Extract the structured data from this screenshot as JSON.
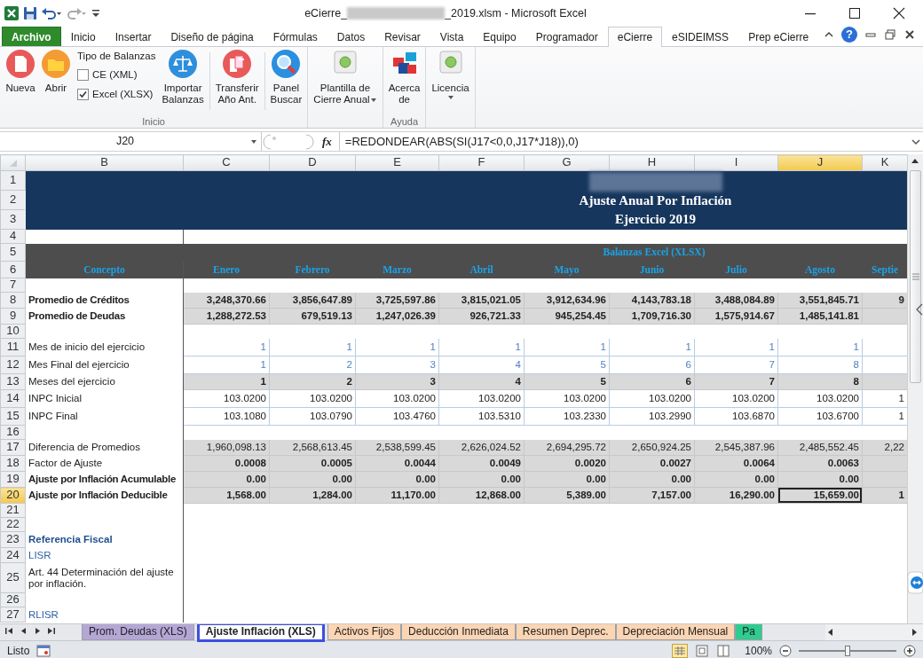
{
  "window": {
    "title_start": "eCierre_",
    "title_end": "_2019.xlsm  -  Microsoft Excel"
  },
  "ribbon": {
    "tabs": [
      {
        "label": "Archivo",
        "kind": "file",
        "selected": false
      },
      {
        "label": "Inicio",
        "kind": "tab",
        "selected": false
      },
      {
        "label": "Insertar",
        "kind": "tab",
        "selected": false
      },
      {
        "label": "Diseño de página",
        "kind": "tab",
        "selected": false
      },
      {
        "label": "Fórmulas",
        "kind": "tab",
        "selected": false
      },
      {
        "label": "Datos",
        "kind": "tab",
        "selected": false
      },
      {
        "label": "Revisar",
        "kind": "tab",
        "selected": false
      },
      {
        "label": "Vista",
        "kind": "tab",
        "selected": false
      },
      {
        "label": "Equipo",
        "kind": "tab",
        "selected": false
      },
      {
        "label": "Programador",
        "kind": "tab",
        "selected": false
      },
      {
        "label": "eCierre",
        "kind": "tab",
        "selected": true
      },
      {
        "label": "eSIDEIMSS",
        "kind": "tab",
        "selected": false
      },
      {
        "label": "Prep eCierre",
        "kind": "tab",
        "selected": false
      }
    ],
    "help": "?",
    "groups": [
      {
        "label": "Inicio",
        "items": [
          {
            "kind": "button",
            "lines": [
              "Nueva"
            ]
          },
          {
            "kind": "button",
            "lines": [
              "Abrir"
            ]
          },
          {
            "kind": "options",
            "title": "Tipo de Balanzas",
            "options": [
              {
                "label": "CE (XML)",
                "checked": false
              },
              {
                "label": "Excel (XLSX)",
                "checked": true
              }
            ]
          },
          {
            "kind": "button",
            "lines": [
              "Importar",
              "Balanzas"
            ]
          },
          {
            "kind": "separator"
          },
          {
            "kind": "button",
            "lines": [
              "Transferir",
              "Año Ant."
            ]
          },
          {
            "kind": "separator"
          },
          {
            "kind": "button",
            "lines": [
              "Panel",
              "Buscar"
            ]
          }
        ]
      },
      {
        "items": [
          {
            "kind": "button",
            "lines": [
              "Plantilla de",
              "Cierre Anual"
            ],
            "dropdown": true
          }
        ]
      },
      {
        "label": "Ayuda",
        "items": [
          {
            "kind": "button",
            "lines": [
              "Acerca",
              "de"
            ]
          }
        ]
      },
      {
        "items": [
          {
            "kind": "button",
            "lines": [
              "Licencia"
            ],
            "dropdown": true
          }
        ]
      }
    ]
  },
  "formula_bar": {
    "name_box": "J20",
    "function_label": "fx",
    "formula": "=REDONDEAR(ABS(SI(J17<0,0,J17*J18)),0)"
  },
  "sheet": {
    "columns": [
      {
        "letter": "B",
        "selected": false
      },
      {
        "letter": "C",
        "selected": false
      },
      {
        "letter": "D",
        "selected": false
      },
      {
        "letter": "E",
        "selected": false
      },
      {
        "letter": "F",
        "selected": false
      },
      {
        "letter": "G",
        "selected": false
      },
      {
        "letter": "H",
        "selected": false
      },
      {
        "letter": "I",
        "selected": false
      },
      {
        "letter": "J",
        "selected": true
      },
      {
        "letter": "K",
        "selected": false
      }
    ],
    "banner_lines": [
      "Ajuste Anual Por Inflación",
      "Ejercicio 2019"
    ],
    "section_title": "Balanzas Excel (XLSX)",
    "concept_label": "Concepto",
    "months": [
      "Enero",
      "Febrero",
      "Marzo",
      "Abril",
      "Mayo",
      "Junio",
      "Julio",
      "Agosto",
      "Septie"
    ],
    "rows": [
      {
        "num": "1",
        "kind": "banner",
        "selected": false
      },
      {
        "num": "2",
        "kind": "banner",
        "selected": false
      },
      {
        "num": "3",
        "kind": "banner",
        "selected": false
      },
      {
        "num": "4",
        "kind": "blank",
        "selected": false
      },
      {
        "num": "5",
        "kind": "section",
        "selected": false
      },
      {
        "num": "6",
        "kind": "months",
        "selected": false
      },
      {
        "num": "7",
        "kind": "blank",
        "selected": false
      },
      {
        "num": "8",
        "kind": "calc",
        "selected": false,
        "label": "Promedio de Créditos",
        "label_bold": true,
        "values_bold": true,
        "values": [
          "3,248,370.66",
          "3,856,647.89",
          "3,725,597.86",
          "3,815,021.05",
          "3,912,634.96",
          "4,143,783.18",
          "3,488,084.89",
          "3,551,845.71",
          "9"
        ]
      },
      {
        "num": "9",
        "kind": "calc",
        "selected": false,
        "label": "Promedio de Deudas",
        "label_bold": true,
        "values_bold": true,
        "values": [
          "1,288,272.53",
          "679,519.13",
          "1,247,026.39",
          "926,721.33",
          "945,254.45",
          "1,709,716.30",
          "1,575,914.67",
          "1,485,141.81"
        ]
      },
      {
        "num": "10",
        "kind": "blank",
        "selected": false
      },
      {
        "num": "11",
        "kind": "param",
        "selected": false,
        "label": "Mes de inicio del ejercicio",
        "label_bold": false,
        "values_bold": false,
        "values": [
          "1",
          "1",
          "1",
          "1",
          "1",
          "1",
          "1",
          "1"
        ]
      },
      {
        "num": "12",
        "kind": "param",
        "selected": false,
        "label": "Mes Final del ejercicio",
        "label_bold": false,
        "values_bold": false,
        "values": [
          "1",
          "2",
          "3",
          "4",
          "5",
          "6",
          "7",
          "8"
        ]
      },
      {
        "num": "13",
        "kind": "calc",
        "selected": false,
        "label": "Meses del ejercicio",
        "label_bold": false,
        "values_bold": true,
        "values": [
          "1",
          "2",
          "3",
          "4",
          "5",
          "6",
          "7",
          "8"
        ]
      },
      {
        "num": "14",
        "kind": "input",
        "selected": false,
        "label": "INPC Inicial",
        "label_bold": false,
        "values_bold": false,
        "values": [
          "103.0200",
          "103.0200",
          "103.0200",
          "103.0200",
          "103.0200",
          "103.0200",
          "103.0200",
          "103.0200",
          "1"
        ]
      },
      {
        "num": "15",
        "kind": "input",
        "selected": false,
        "label": "INPC Final",
        "label_bold": false,
        "values_bold": false,
        "values": [
          "103.1080",
          "103.0790",
          "103.4760",
          "103.5310",
          "103.2330",
          "103.2990",
          "103.6870",
          "103.6700",
          "1"
        ]
      },
      {
        "num": "16",
        "kind": "blank",
        "selected": false
      },
      {
        "num": "17",
        "kind": "calc",
        "selected": false,
        "label": "Diferencia de Promedios",
        "label_bold": false,
        "values_bold": false,
        "values": [
          "1,960,098.13",
          "2,568,613.45",
          "2,538,599.45",
          "2,626,024.52",
          "2,694,295.72",
          "2,650,924.25",
          "2,545,387.96",
          "2,485,552.45",
          "2,22"
        ]
      },
      {
        "num": "18",
        "kind": "calc",
        "selected": false,
        "label": "Factor de Ajuste",
        "label_bold": false,
        "values_bold": true,
        "values": [
          "0.0008",
          "0.0005",
          "0.0044",
          "0.0049",
          "0.0020",
          "0.0027",
          "0.0064",
          "0.0063"
        ]
      },
      {
        "num": "19",
        "kind": "calc",
        "selected": false,
        "label": "Ajuste por Inflación Acumulable",
        "label_bold": true,
        "values_bold": true,
        "values": [
          "0.00",
          "0.00",
          "0.00",
          "0.00",
          "0.00",
          "0.00",
          "0.00",
          "0.00"
        ]
      },
      {
        "num": "20",
        "kind": "calc",
        "selected": true,
        "label": "Ajuste por Inflación Deducible",
        "label_bold": true,
        "values_bold": true,
        "values": [
          "1,568.00",
          "1,284.00",
          "11,170.00",
          "12,868.00",
          "5,389.00",
          "7,157.00",
          "16,290.00",
          "15,659.00",
          "1"
        ]
      },
      {
        "num": "21",
        "kind": "blank",
        "selected": false
      },
      {
        "num": "22",
        "kind": "blank",
        "selected": false
      },
      {
        "num": "23",
        "kind": "note_heading",
        "selected": false,
        "label": "Referencia Fiscal"
      },
      {
        "num": "24",
        "kind": "note_link",
        "selected": false,
        "label": "LISR"
      },
      {
        "num": "25",
        "kind": "note_text",
        "selected": false,
        "label": "Art. 44  Determinación del ajuste por inflación."
      },
      {
        "num": "26",
        "kind": "blank",
        "selected": false
      },
      {
        "num": "27",
        "kind": "note_link",
        "selected": false,
        "label": "RLISR"
      }
    ]
  },
  "sheet_tabs": [
    {
      "label": "Prom. Deudas (XLS)",
      "color": "#b4a7d6",
      "selected": false
    },
    {
      "label": "Ajuste Inflación (XLS)",
      "selected": true
    },
    {
      "label": "Activos Fijos",
      "color": "#fcd5b4",
      "selected": false
    },
    {
      "label": "Deducción Inmediata",
      "color": "#fcd5b4",
      "selected": false
    },
    {
      "label": "Resumen Deprec.",
      "color": "#fcd5b4",
      "selected": false
    },
    {
      "label": "Depreciación Mensual",
      "color": "#fcd5b4",
      "selected": false
    },
    {
      "label": "Pa",
      "color": "#2ecc8f",
      "selected": false
    }
  ],
  "status_bar": {
    "ready": "Listo",
    "zoom": "100%",
    "zoom_slider": {
      "level": 0.5
    }
  }
}
